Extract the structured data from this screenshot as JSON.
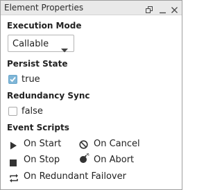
{
  "panel": {
    "title": "Element Properties",
    "icons": [
      "restore-window-icon",
      "minimize-icon",
      "close-icon"
    ]
  },
  "execution_mode": {
    "label": "Execution Mode",
    "selected": "Callable"
  },
  "persist_state": {
    "label": "Persist State",
    "checked": true,
    "value_text": "true"
  },
  "redundancy_sync": {
    "label": "Redundancy Sync",
    "checked": false,
    "value_text": "false"
  },
  "event_scripts": {
    "label": "Event Scripts",
    "items": [
      {
        "label": "On Start",
        "icon": "play-icon"
      },
      {
        "label": "On Cancel",
        "icon": "cancel-icon"
      },
      {
        "label": "On Stop",
        "icon": "stop-icon"
      },
      {
        "label": "On Abort",
        "icon": "bomb-icon"
      },
      {
        "label": "On Redundant Failover",
        "icon": "failover-icon"
      }
    ]
  },
  "colors": {
    "titlebar": "#e9e9e9",
    "checkbox_checked": "#7fb6d7",
    "icon": "#333333"
  }
}
